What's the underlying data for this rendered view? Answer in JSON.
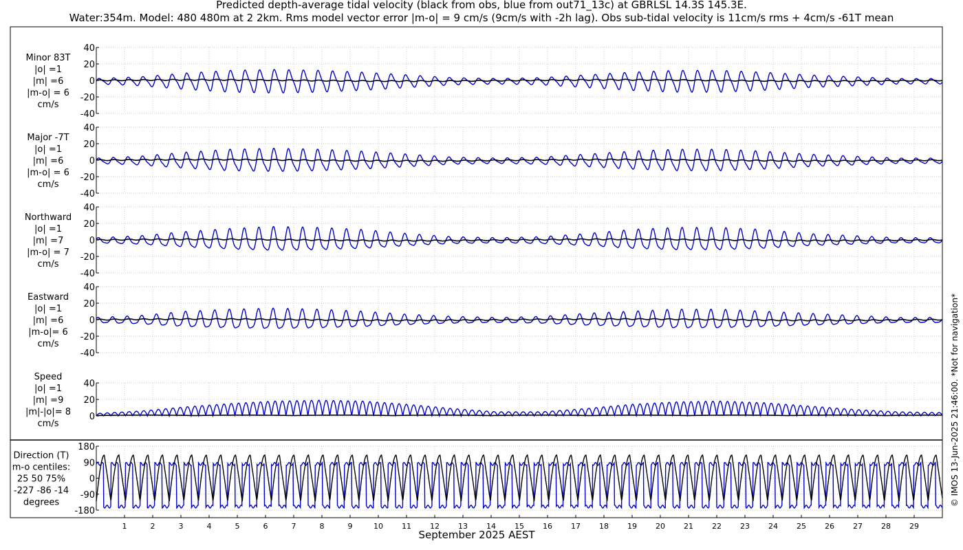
{
  "title": {
    "line1": "Predicted depth-average tidal velocity (black from obs, blue from out71_13c) at GBRLSL 14.3S 145.3E.",
    "line2": "Water:354m. Model: 480 480m at 2 2km. Rms model vector error |m-o| = 9 cm/s (9cm/s with -2h lag). Obs sub-tidal velocity is 11cm/s rms + 4cm/s -61T mean"
  },
  "xlabel": "September 2025 AEST",
  "copyright": "© IMOS 13-Jun-2025 21:46:00. *Not for navigation*",
  "colors": {
    "obs": "#000000",
    "model": "#0000cc",
    "grid": "#b8b8b8"
  },
  "chart_data": [
    {
      "type": "line",
      "label": [
        "Minor 83T",
        "|o| =1",
        "|m| =6",
        "|m-o| = 6",
        "cm/s"
      ],
      "ylim": [
        -40,
        40
      ],
      "yticks": [
        40,
        20,
        0,
        -20,
        -40
      ],
      "xlim": [
        0,
        30
      ],
      "xticks": [
        1,
        2,
        3,
        4,
        5,
        6,
        7,
        8,
        9,
        10,
        11,
        12,
        13,
        14,
        15,
        16,
        17,
        18,
        19,
        20,
        21,
        22,
        23,
        24,
        25,
        26,
        27,
        28,
        29
      ],
      "grid": true,
      "series": [
        {
          "amp_envelope": [
            3,
            5,
            9,
            12,
            13,
            12,
            10,
            7,
            4,
            3,
            4,
            7,
            10,
            12,
            12,
            10,
            7,
            5,
            3,
            3
          ],
          "mean": -1
        },
        {
          "amp": 1,
          "mean": 0
        }
      ]
    },
    {
      "type": "line",
      "label": [
        "Major -7T",
        "|o| =1",
        "|m| =6",
        "|m-o| = 6",
        "cm/s"
      ],
      "ylim": [
        -40,
        40
      ],
      "yticks": [
        40,
        20,
        0,
        -20,
        -40
      ],
      "xlim": [
        0,
        30
      ],
      "grid": true,
      "series": [
        {
          "amp_envelope": [
            3,
            5,
            9,
            12,
            13,
            12,
            10,
            7,
            4,
            3,
            4,
            7,
            10,
            12,
            12,
            10,
            7,
            5,
            3,
            3
          ],
          "mean": -1
        },
        {
          "amp": 1,
          "mean": 0
        }
      ]
    },
    {
      "type": "line",
      "label": [
        "Northward",
        "|o| =1",
        "|m| =7",
        "|m-o| = 7",
        "cm/s"
      ],
      "ylim": [
        -40,
        40
      ],
      "yticks": [
        40,
        20,
        0,
        -20,
        -40
      ],
      "xlim": [
        0,
        30
      ],
      "grid": true,
      "series": [
        {
          "amp_envelope": [
            3,
            5,
            9,
            12,
            14,
            13,
            11,
            7,
            4,
            3,
            4,
            7,
            11,
            13,
            13,
            11,
            7,
            5,
            3,
            3
          ],
          "mean": -1
        },
        {
          "amp": 1,
          "mean": 0
        }
      ]
    },
    {
      "type": "line",
      "label": [
        "Eastward",
        "|o| =1",
        "|m| =6",
        "|m-o|= 6",
        "cm/s"
      ],
      "ylim": [
        -40,
        40
      ],
      "yticks": [
        40,
        20,
        0,
        -20,
        -40
      ],
      "xlim": [
        0,
        30
      ],
      "grid": true,
      "series": [
        {
          "amp_envelope": [
            3,
            5,
            9,
            11,
            12,
            11,
            9,
            6,
            4,
            3,
            4,
            7,
            9,
            11,
            11,
            9,
            7,
            5,
            3,
            3
          ],
          "mean": -1
        },
        {
          "amp": 1,
          "mean": 0
        }
      ]
    },
    {
      "type": "line",
      "label": [
        "Speed",
        "|o| =1",
        "|m| =9",
        "|m|-|o|= 8",
        "cm/s"
      ],
      "ylim": [
        0,
        40
      ],
      "yticks": [
        40,
        20,
        0
      ],
      "xlim": [
        0,
        30
      ],
      "grid": true,
      "series": [
        {
          "peak_envelope": [
            3,
            6,
            11,
            15,
            18,
            19,
            18,
            14,
            9,
            5,
            5,
            9,
            14,
            17,
            18,
            16,
            12,
            8,
            5,
            4
          ]
        },
        {
          "amp": 1
        }
      ]
    },
    {
      "type": "line",
      "label": [
        "Direction (T)",
        "m-o centiles:",
        "25  50  75%",
        "-227  -86  -14",
        "degrees"
      ],
      "ylim": [
        -180,
        180
      ],
      "yticks": [
        180,
        90,
        0,
        -90,
        -180
      ],
      "xlim": [
        0,
        30
      ],
      "grid": true,
      "series": [
        {
          "kind": "sawtooth",
          "high": 130,
          "low": -130
        },
        {
          "kind": "square",
          "high": 80,
          "low": -160
        }
      ]
    }
  ]
}
